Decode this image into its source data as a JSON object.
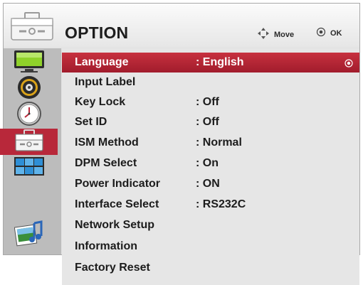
{
  "header": {
    "title": "OPTION",
    "move_label": "Move",
    "ok_label": "OK"
  },
  "sidebar": {
    "items": [
      {
        "icon": "picture-monitor-icon",
        "active": false
      },
      {
        "icon": "audio-speaker-icon",
        "active": false
      },
      {
        "icon": "time-clock-icon",
        "active": false
      },
      {
        "icon": "option-toolbox-icon",
        "active": true
      },
      {
        "icon": "screen-tiles-icon",
        "active": false
      },
      {
        "icon": "photo-music-icon",
        "active": false
      }
    ]
  },
  "menu": {
    "items": [
      {
        "label": "Language",
        "value": ": English",
        "selected": true
      },
      {
        "label": "Input Label",
        "value": ""
      },
      {
        "label": "Key Lock",
        "value": ": Off"
      },
      {
        "label": "Set ID",
        "value": ": Off"
      },
      {
        "label": "ISM Method",
        "value": ": Normal"
      },
      {
        "label": "DPM Select",
        "value": ": On"
      },
      {
        "label": "Power Indicator",
        "value": ": ON"
      },
      {
        "label": "Interface Select",
        "value": ": RS232C"
      },
      {
        "label": "Network Setup",
        "value": ""
      },
      {
        "label": "Information",
        "value": ""
      },
      {
        "label": "Factory Reset",
        "value": ""
      }
    ]
  },
  "colors": {
    "accent": "#b8283a",
    "panel": "#e6e6e6",
    "sidebar": "#bcbcbc"
  }
}
